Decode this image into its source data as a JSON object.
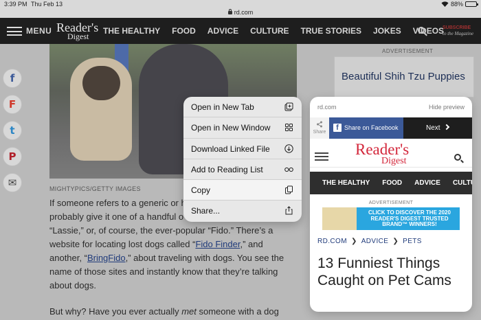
{
  "status": {
    "time": "3:39 PM",
    "date": "Thu Feb 13",
    "battery": "88%",
    "battery_level": 0.88
  },
  "browser": {
    "url": "rd.com"
  },
  "site_nav": {
    "menu_label": "MENU",
    "logo_line1": "Reader's",
    "logo_line2": "Digest",
    "links": [
      "THE HEALTHY",
      "FOOD",
      "ADVICE",
      "CULTURE",
      "TRUE STORIES",
      "JOKES",
      "VIDEOS"
    ],
    "subscribe": "SUBSCRIBE",
    "subscribe_sub": "to the Magazine"
  },
  "article": {
    "photo_credit": "MIGHTYPICS/GETTY IMAGES",
    "p1_a": "If someone refers to a generic or h",
    "p1_b": "probably give it one of a handful o",
    "p1_c": "“Lassie,” or, of course, the ever-popular “Fido.” There’s a",
    "p1_d": "website for locating lost dogs called “",
    "link1": "Fido Finder",
    "p1_e": ",” and",
    "p1_f": "another, “",
    "link2": "BringFido",
    "p1_g": ",” about traveling with dogs. You see the",
    "p1_h": "name of those sites and instantly know that they’re talking",
    "p1_i": "about dogs.",
    "p2_a": "But why? Have you ever actually ",
    "p2_em": "met",
    "p2_b": " someone with a dog"
  },
  "social": [
    "f",
    "F",
    "t",
    "P",
    "✉"
  ],
  "sidebar_ad": {
    "label": "ADVERTISEMENT",
    "headline": "Beautiful Shih Tzu Puppies"
  },
  "context_menu": {
    "items": [
      {
        "label": "Open in New Tab",
        "icon": "plus-square-icon"
      },
      {
        "label": "Open in New Window",
        "icon": "grid-icon"
      },
      {
        "label": "Download Linked File",
        "icon": "download-icon"
      },
      {
        "label": "Add to Reading List",
        "icon": "glasses-icon"
      },
      {
        "label": "Copy",
        "icon": "copy-icon"
      },
      {
        "label": "Share...",
        "icon": "share-icon"
      }
    ]
  },
  "preview": {
    "domain": "rd.com",
    "hide": "Hide preview",
    "share_label": "Share",
    "facebook": "Share on Facebook",
    "next": "Next",
    "logo_line1": "Reader's",
    "logo_line2": "Digest",
    "nav": [
      "THE HEALTHY",
      "FOOD",
      "ADVICE",
      "CULTU"
    ],
    "ad_label": "ADVERTISEMENT",
    "banner": "CLICK TO DISCOVER THE 2020 READER'S DIGEST TRUSTED BRAND™ WINNERS!",
    "crumbs": [
      "RD.COM",
      "ADVICE",
      "PETS"
    ],
    "crumb_sep": "❯",
    "title": "13 Funniest Things Caught on Pet Cams"
  }
}
